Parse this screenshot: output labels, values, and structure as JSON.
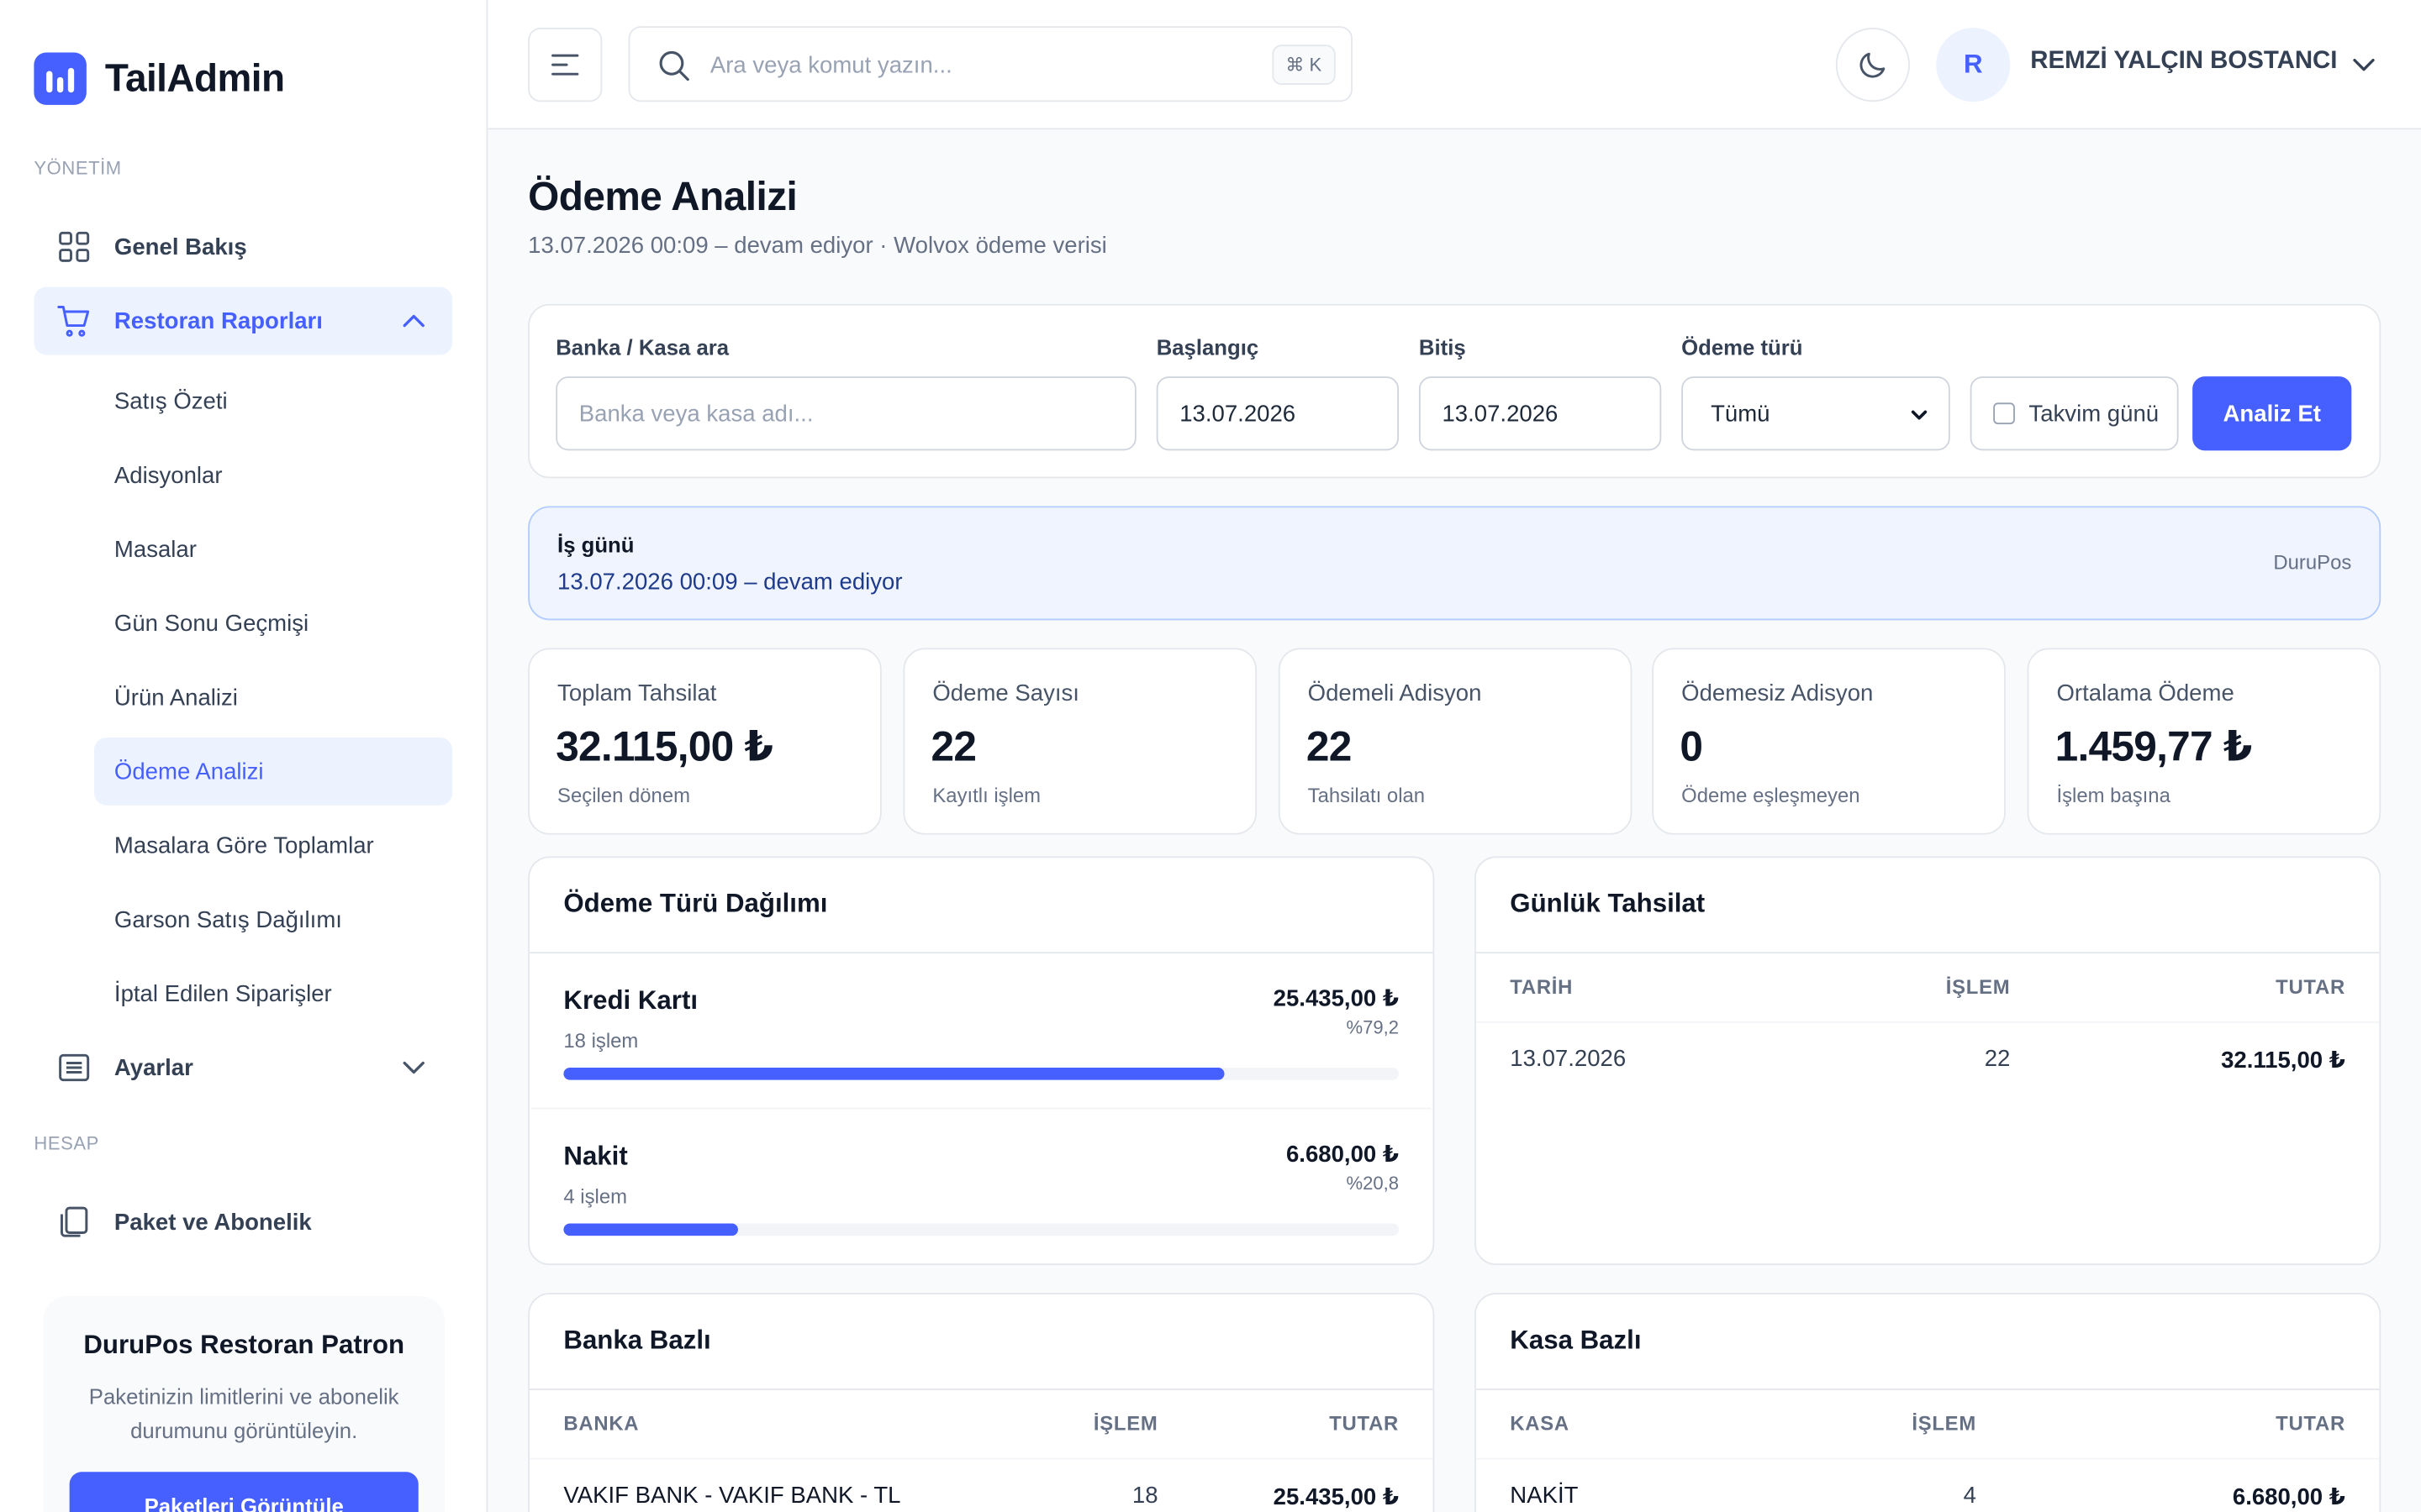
{
  "brand": {
    "name": "TailAdmin"
  },
  "sidebar": {
    "section_management": "YÖNETİM",
    "section_account": "HESAP",
    "items": [
      {
        "label": "Genel Bakış"
      },
      {
        "label": "Restoran Raporları"
      },
      {
        "label": "Ayarlar"
      },
      {
        "label": "Paket ve Abonelik"
      }
    ],
    "sub_items": [
      {
        "label": "Satış Özeti"
      },
      {
        "label": "Adisyonlar"
      },
      {
        "label": "Masalar"
      },
      {
        "label": "Gün Sonu Geçmişi"
      },
      {
        "label": "Ürün Analizi"
      },
      {
        "label": "Ödeme Analizi"
      },
      {
        "label": "Masalara Göre Toplamlar"
      },
      {
        "label": "Garson Satış Dağılımı"
      },
      {
        "label": "İptal Edilen Siparişler"
      }
    ],
    "promo": {
      "title": "DuruPos Restoran Patron",
      "text": "Paketinizin limitlerini ve abonelik durumunu görüntüleyin.",
      "button": "Paketleri Görüntüle"
    }
  },
  "header": {
    "search_placeholder": "Ara veya komut yazın...",
    "shortcut": "⌘ K",
    "avatar_initial": "R",
    "user_name": "REMZİ YALÇIN BOSTANCI"
  },
  "page": {
    "title": "Ödeme Analizi",
    "subtitle": "13.07.2026 00:09 – devam ediyor · Wolvox ödeme verisi"
  },
  "filters": {
    "bank_label": "Banka / Kasa ara",
    "bank_placeholder": "Banka veya kasa adı...",
    "start_label": "Başlangıç",
    "start_value": "13.07.2026",
    "end_label": "Bitiş",
    "end_value": "13.07.2026",
    "type_label": "Ödeme türü",
    "type_value": "Tümü",
    "calendar_day": "Takvim günü",
    "analyze_button": "Analiz Et"
  },
  "business_day": {
    "title": "İş günü",
    "text": "13.07.2026 00:09 – devam ediyor",
    "source": "DuruPos"
  },
  "stats": [
    {
      "label": "Toplam Tahsilat",
      "value": "32.115,00 ₺",
      "sub": "Seçilen dönem"
    },
    {
      "label": "Ödeme Sayısı",
      "value": "22",
      "sub": "Kayıtlı işlem"
    },
    {
      "label": "Ödemeli Adisyon",
      "value": "22",
      "sub": "Tahsilatı olan"
    },
    {
      "label": "Ödemesiz Adisyon",
      "value": "0",
      "sub": "Ödeme eşleşmeyen"
    },
    {
      "label": "Ortalama Ödeme",
      "value": "1.459,77 ₺",
      "sub": "İşlem başına"
    }
  ],
  "distribution": {
    "title": "Ödeme Türü Dağılımı",
    "rows": [
      {
        "name": "Kredi Kartı",
        "count": "18 işlem",
        "amount": "25.435,00 ₺",
        "percent": "%79,2",
        "share": 0.792
      },
      {
        "name": "Nakit",
        "count": "4 işlem",
        "amount": "6.680,00 ₺",
        "percent": "%20,8",
        "share": 0.208
      }
    ]
  },
  "daily": {
    "title": "Günlük Tahsilat",
    "columns": [
      "TARİH",
      "İŞLEM",
      "TUTAR"
    ],
    "rows": [
      {
        "date": "13.07.2026",
        "count": "22",
        "amount": "32.115,00 ₺"
      }
    ]
  },
  "bank": {
    "title": "Banka Bazlı",
    "columns": [
      "BANKA",
      "İŞLEM",
      "TUTAR"
    ],
    "rows": [
      {
        "name": "VAKIF BANK - VAKIF BANK - TL",
        "count": "18",
        "amount": "25.435,00 ₺"
      }
    ]
  },
  "cash": {
    "title": "Kasa Bazlı",
    "columns": [
      "KASA",
      "İŞLEM",
      "TUTAR"
    ],
    "rows": [
      {
        "name": "NAKİT",
        "count": "4",
        "amount": "6.680,00 ₺"
      }
    ]
  },
  "colors": {
    "accent": "#465fff",
    "accent_soft": "#ecf3ff",
    "info_bg": "#eff4ff"
  }
}
